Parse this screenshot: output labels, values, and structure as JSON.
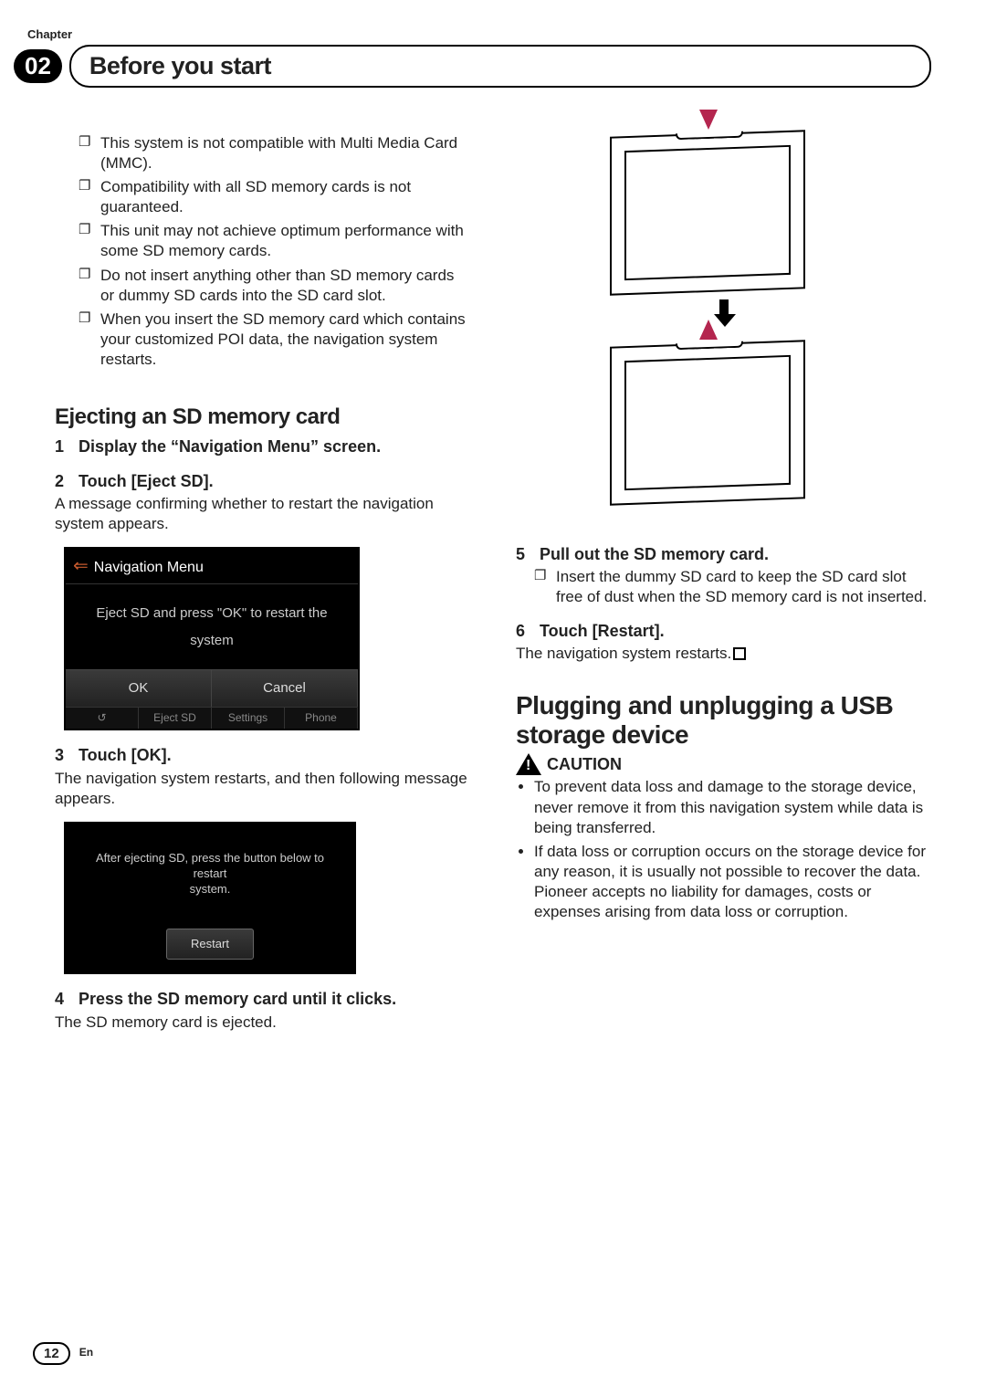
{
  "chapter_label": "Chapter",
  "chapter_number": "02",
  "chapter_title": "Before you start",
  "left": {
    "notes": [
      "This system is not compatible with Multi Media Card (MMC).",
      "Compatibility with all SD memory cards is not guaranteed.",
      "This unit may not achieve optimum performance with some SD memory cards.",
      "Do not insert anything other than SD memory cards or dummy SD cards into the SD card slot.",
      "When you insert the SD memory card which contains your customized POI data, the navigation system restarts."
    ],
    "eject_heading": "Ejecting an SD memory card",
    "step1": {
      "num": "1",
      "title": "Display the “Navigation Menu” screen."
    },
    "step2": {
      "num": "2",
      "title": "Touch [Eject SD].",
      "body": "A message confirming whether to restart the navigation system appears."
    },
    "ss1": {
      "title": "Navigation Menu",
      "msg_line1": "Eject SD and press \"OK\" to restart the",
      "msg_line2": "system",
      "btn_ok": "OK",
      "btn_cancel": "Cancel",
      "tab1": "Eject SD",
      "tab2": "Settings",
      "tab3": "Phone"
    },
    "step3": {
      "num": "3",
      "title": "Touch [OK].",
      "body": "The navigation system restarts, and then following message appears."
    },
    "ss2": {
      "msg_line1": "After ejecting SD, press the button below to restart",
      "msg_line2": "system.",
      "btn": "Restart"
    },
    "step4": {
      "num": "4",
      "title": "Press the SD memory card until it clicks.",
      "body": "The SD memory card is ejected."
    }
  },
  "right": {
    "step5": {
      "num": "5",
      "title": "Pull out the SD memory card.",
      "note": "Insert the dummy SD card to keep the SD card slot free of dust when the SD memory card is not inserted."
    },
    "step6": {
      "num": "6",
      "title": "Touch [Restart].",
      "body": "The navigation system restarts."
    },
    "usb_heading": "Plugging and unplugging a USB storage device",
    "caution_label": "CAUTION",
    "caution_bullets": [
      "To prevent data loss and damage to the storage device, never remove it from this navigation system while data is being transferred.",
      "If data loss or corruption occurs on the storage device for any reason, it is usually not possible to recover the data. Pioneer accepts no liability for damages, costs or expenses arising from data loss or corruption."
    ]
  },
  "footer": {
    "page": "12",
    "lang": "En"
  }
}
